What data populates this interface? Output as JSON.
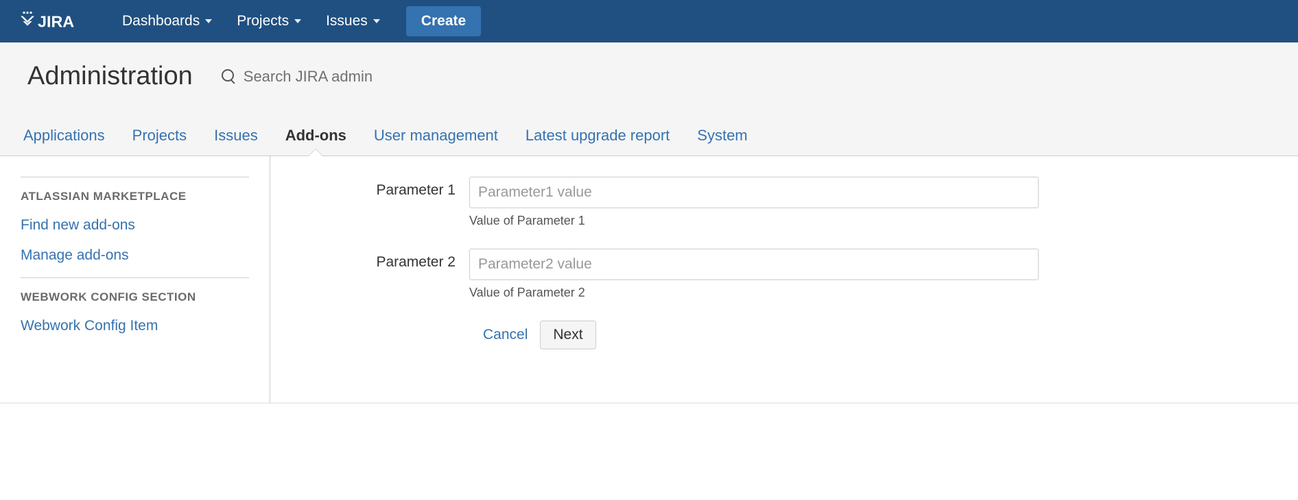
{
  "topnav": {
    "logo_text": "JIRA",
    "items": [
      {
        "label": "Dashboards"
      },
      {
        "label": "Projects"
      },
      {
        "label": "Issues"
      }
    ],
    "create_label": "Create"
  },
  "admin_header": {
    "title": "Administration",
    "search_placeholder": "Search JIRA admin"
  },
  "admin_tabs": [
    {
      "label": "Applications",
      "active": false
    },
    {
      "label": "Projects",
      "active": false
    },
    {
      "label": "Issues",
      "active": false
    },
    {
      "label": "Add-ons",
      "active": true
    },
    {
      "label": "User management",
      "active": false
    },
    {
      "label": "Latest upgrade report",
      "active": false
    },
    {
      "label": "System",
      "active": false
    }
  ],
  "sidebar": {
    "groups": [
      {
        "heading": "ATLASSIAN MARKETPLACE",
        "links": [
          "Find new add-ons",
          "Manage add-ons"
        ]
      },
      {
        "heading": "WEBWORK CONFIG SECTION",
        "links": [
          "Webwork Config Item"
        ]
      }
    ]
  },
  "form": {
    "fields": [
      {
        "label": "Parameter 1",
        "placeholder": "Parameter1 value",
        "hint": "Value of Parameter 1"
      },
      {
        "label": "Parameter 2",
        "placeholder": "Parameter2 value",
        "hint": "Value of Parameter 2"
      }
    ],
    "cancel_label": "Cancel",
    "next_label": "Next"
  }
}
